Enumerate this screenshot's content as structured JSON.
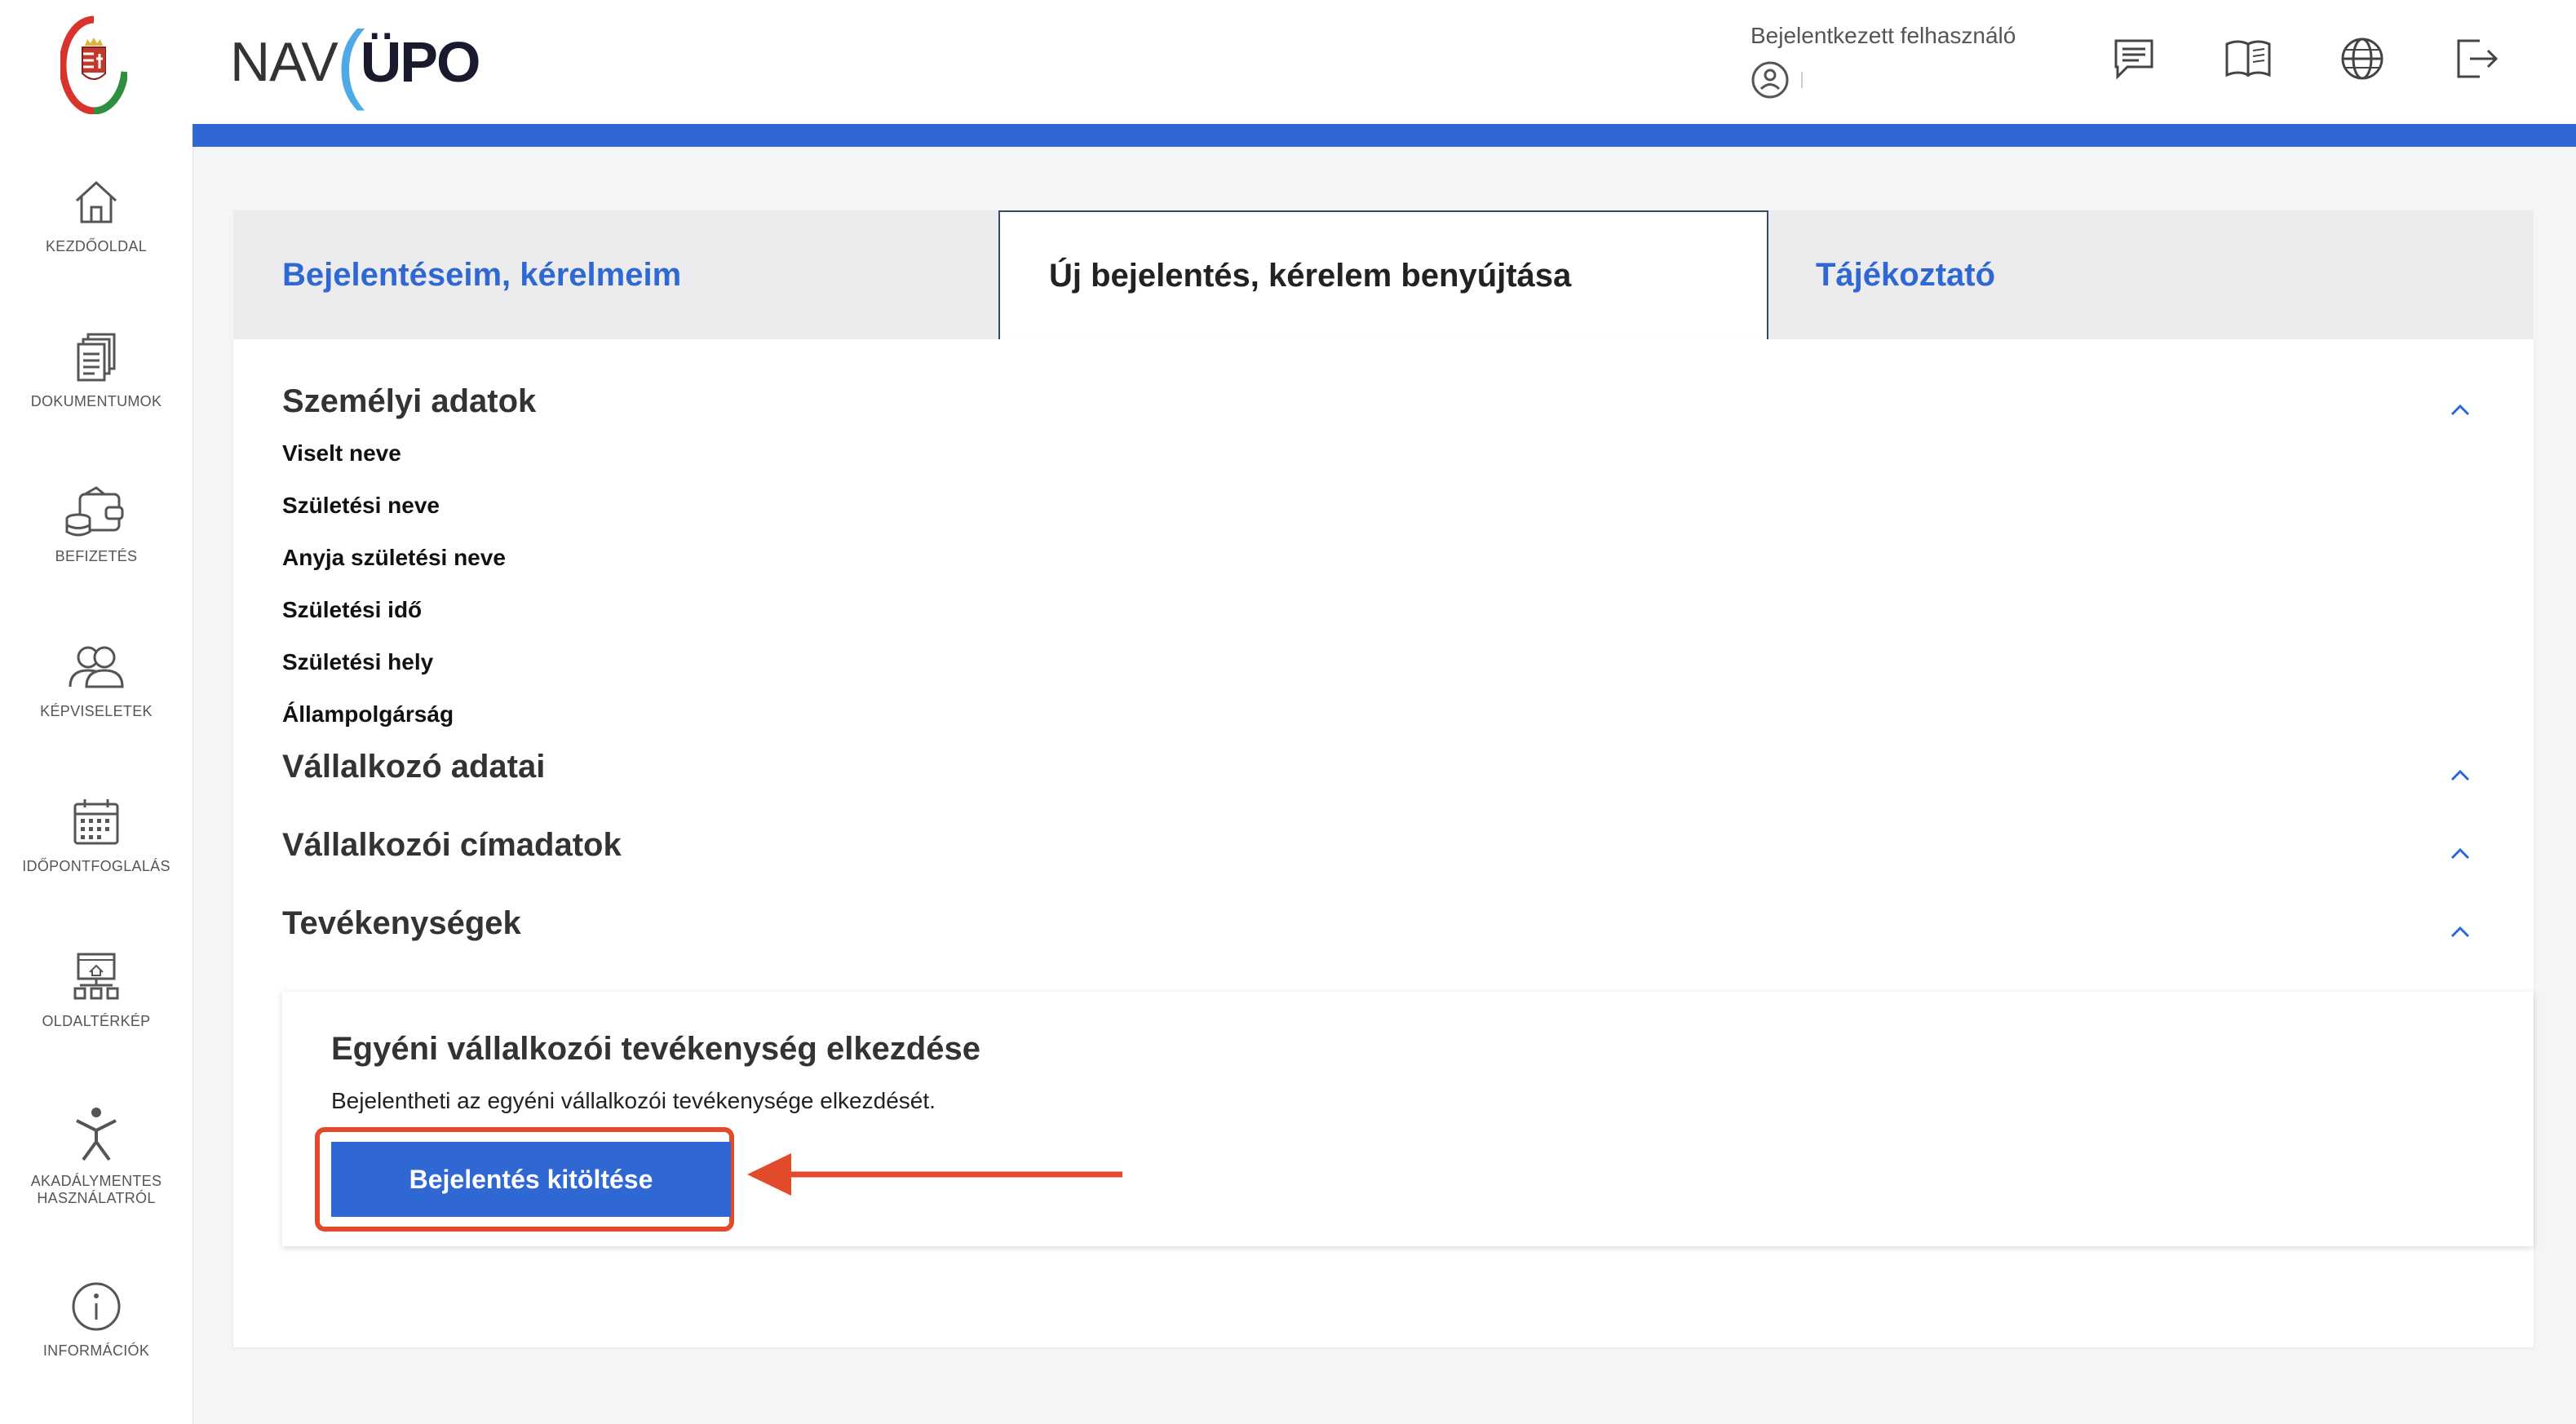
{
  "sidebar": {
    "items": [
      {
        "label": "KEZDŐOLDAL",
        "icon": "home-icon"
      },
      {
        "label": "DOKUMENTUMOK",
        "icon": "documents-icon"
      },
      {
        "label": "BEFIZETÉS",
        "icon": "wallet-icon"
      },
      {
        "label": "KÉPVISELETEK",
        "icon": "people-icon"
      },
      {
        "label": "IDŐPONTFOGLALÁS",
        "icon": "calendar-icon"
      },
      {
        "label": "OLDALTÉRKÉP",
        "icon": "sitemap-icon"
      },
      {
        "label": "AKADÁLYMENTES",
        "label2": "HASZNÁLATRÓL",
        "icon": "accessibility-icon"
      },
      {
        "label": "INFORMÁCIÓK",
        "icon": "info-icon"
      }
    ]
  },
  "header": {
    "logo_nav": "NAV",
    "logo_upo": "ÜPO",
    "user_title": "Bejelentkezett felhasználó",
    "icons": [
      "message-icon",
      "book-icon",
      "globe-icon",
      "logout-icon"
    ]
  },
  "tabs": [
    {
      "label": "Bejelentéseim, kérelmeim",
      "active": false
    },
    {
      "label": "Új bejelentés, kérelem benyújtása",
      "active": true
    },
    {
      "label": "Tájékoztató",
      "active": false
    }
  ],
  "sections": {
    "personal": {
      "title": "Személyi adatok",
      "fields": [
        "Viselt neve",
        "Születési neve",
        "Anyja születési neve",
        "Születési idő",
        "Születési hely",
        "Állampolgárság"
      ]
    },
    "entrepreneur": {
      "title": "Vállalkozó adatai"
    },
    "address": {
      "title": "Vállalkozói címadatok"
    },
    "activities": {
      "title": "Tevékenységek"
    }
  },
  "card": {
    "title": "Egyéni vállalkozói tevékenység elkezdése",
    "description": "Bejelentheti az egyéni vállalkozói tevékenysége elkezdését.",
    "button_label": "Bejelentés kitöltése"
  },
  "colors": {
    "accent": "#2f68d2",
    "annotation": "#e24a2c",
    "logo_arc": "#4da9e8"
  }
}
